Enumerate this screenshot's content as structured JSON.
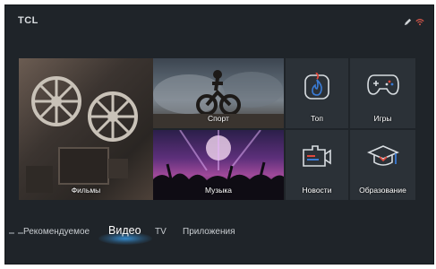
{
  "header": {
    "logo": "TCL",
    "status_icons": [
      "edit-icon",
      "wifi-icon"
    ]
  },
  "tiles": [
    {
      "label": "Фильмы",
      "icon": "film-projector-image"
    },
    {
      "label": "Спорт",
      "icon": "motocross-image"
    },
    {
      "label": "Музыка",
      "icon": "concert-image"
    },
    {
      "label": "Топ",
      "icon": "flame-icon"
    },
    {
      "label": "Игры",
      "icon": "gamepad-icon"
    },
    {
      "label": "Новости",
      "icon": "news-camera-icon"
    },
    {
      "label": "Образование",
      "icon": "graduation-cap-icon"
    }
  ],
  "nav": {
    "tabs": [
      "Рекомендуемое",
      "Видео",
      "TV",
      "Приложения"
    ],
    "active": "Видео"
  },
  "colors": {
    "background": "#1f2429",
    "tile": "#2b3137",
    "accent_glow": "#3caaff",
    "icon_red": "#e0483c",
    "icon_blue": "#3a7bd5"
  }
}
